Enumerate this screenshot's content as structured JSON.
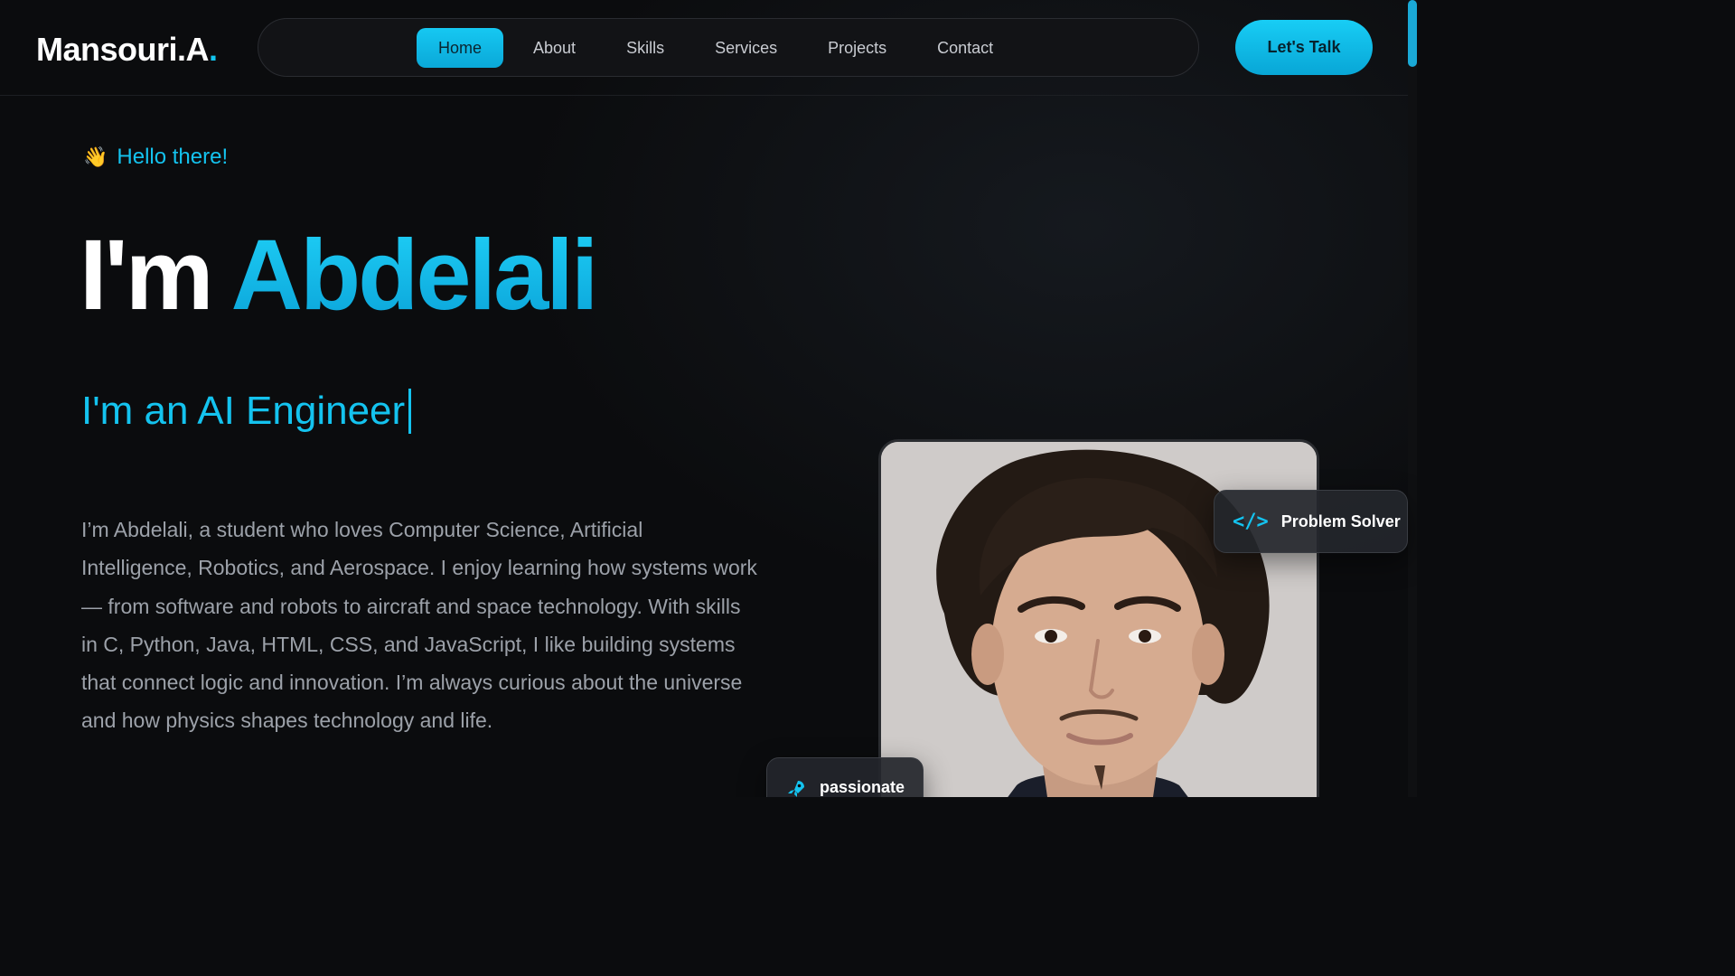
{
  "header": {
    "logo": {
      "text": "Mansouri.A",
      "dot": "."
    },
    "nav": [
      {
        "label": "Home",
        "active": true
      },
      {
        "label": "About"
      },
      {
        "label": "Skills"
      },
      {
        "label": "Services"
      },
      {
        "label": "Projects"
      },
      {
        "label": "Contact"
      }
    ],
    "cta_label": "Let's Talk"
  },
  "hero": {
    "greeting": "Hello there!",
    "greeting_icon": "waving-hand-icon",
    "headline_prefix": "I'm",
    "headline_name": "Abdelali",
    "role": "I'm an AI Engineer",
    "bio": "I’m Abdelali, a student who loves Computer Science, Artificial Intelligence, Robotics, and Aerospace. I enjoy learning how systems work — from software and robots to aircraft and space technology. With skills in C, Python, Java, HTML, CSS, and JavaScript, I like building systems that connect logic and innovation. I’m always curious about the universe and how physics shapes technology and life."
  },
  "badges": {
    "problem_solver": {
      "label": "Problem Solver",
      "icon": "code-icon"
    },
    "passionate": {
      "label": "passionate",
      "icon": "rocket-icon"
    }
  },
  "colors": {
    "accent": "#14c3ef",
    "background": "#0b0c0e",
    "nav_bg": "#121316",
    "body_text": "#9ca1a9"
  }
}
